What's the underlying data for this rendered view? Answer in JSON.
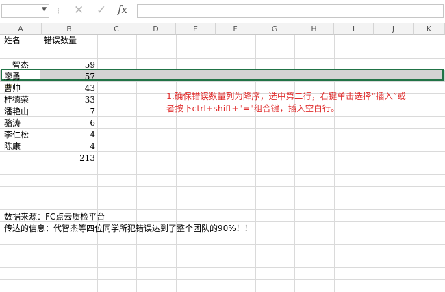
{
  "formula_bar": {
    "name_box_value": "",
    "fx_label": "fx",
    "formula_value": ""
  },
  "columns": [
    "A",
    "B",
    "C",
    "D",
    "E",
    "F",
    "G",
    "H",
    "I",
    "J",
    "K"
  ],
  "header": {
    "name": "姓名",
    "errors": "错误数量"
  },
  "rows": [
    {
      "name": "智杰",
      "count": "59"
    },
    {
      "name": "廖勇",
      "count": "57"
    },
    {
      "name": "曹帅",
      "count": "43"
    },
    {
      "name": "桂德荣",
      "count": "33"
    },
    {
      "name": "潘艳山",
      "count": "7"
    },
    {
      "name": "骆涛",
      "count": "6"
    },
    {
      "name": "李仁松",
      "count": "4"
    },
    {
      "name": "陈康",
      "count": "4"
    }
  ],
  "total": "213",
  "source_line": "数据来源：FC点云质检平台",
  "message_line": "传达的信息：代智杰等四位同学所犯错误达到了整个团队的90%！！",
  "annotation": {
    "line1": "1.确保错误数量列为降序，选中第二行，右键单击选择“插入”或",
    "line2": "者按下ctrl+shift+\"=\"组合键，插入空白行。"
  },
  "colors": {
    "selection": "#217346",
    "annotation": "#e03030"
  }
}
